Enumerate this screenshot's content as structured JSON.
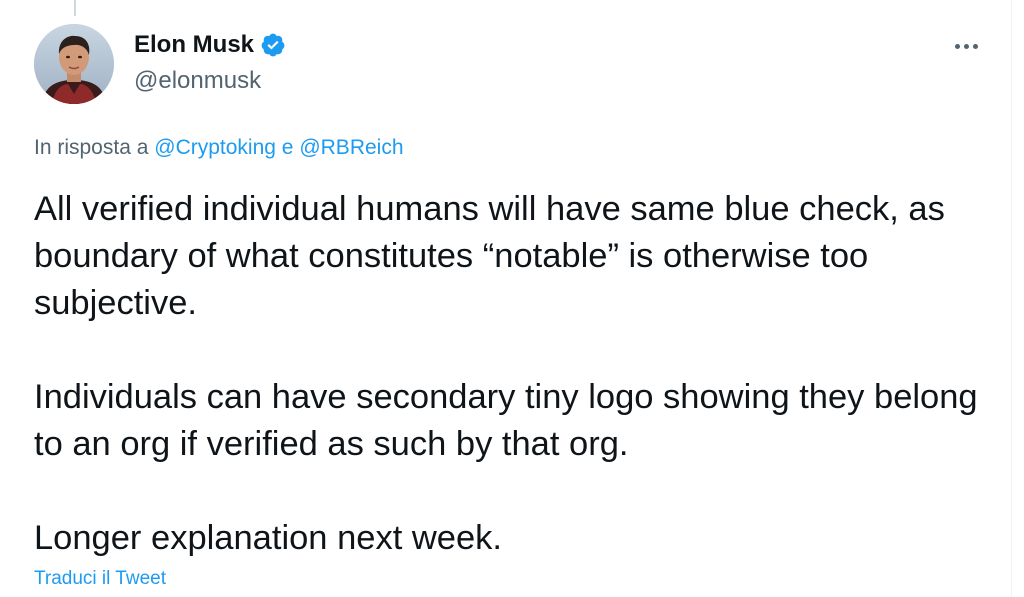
{
  "author": {
    "display_name": "Elon Musk",
    "handle": "@elonmusk",
    "verified": true,
    "avatar_icon": "profile-photo"
  },
  "reply_context": {
    "prefix": "In risposta a",
    "mentions": [
      "@Cryptoking",
      "@RBReich"
    ],
    "conjunction": "e"
  },
  "tweet": {
    "paragraphs": [
      "All verified individual humans will have same blue check, as boundary of what constitutes “notable” is otherwise too subjective.",
      "Individuals can have secondary tiny logo showing they belong to an org if verified as such by that org.",
      "Longer explanation next week."
    ]
  },
  "actions": {
    "more_icon": "more-horizontal-icon",
    "translate_label": "Traduci il Tweet"
  },
  "colors": {
    "text_primary": "#0f1419",
    "text_secondary": "#536471",
    "accent": "#1d9bf0"
  }
}
